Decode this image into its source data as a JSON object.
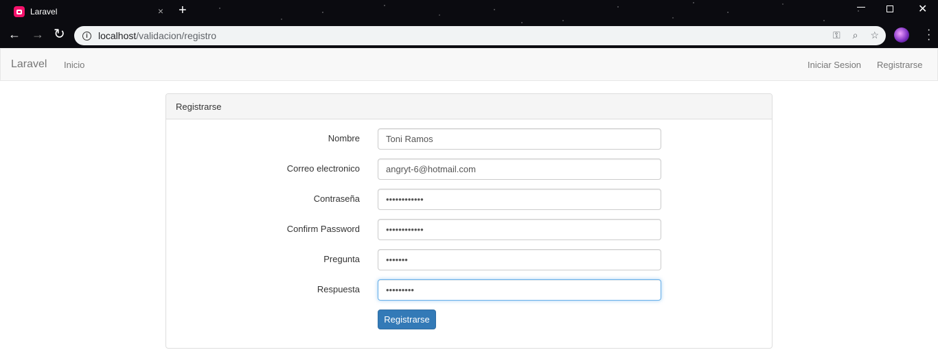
{
  "browser": {
    "tab_title": "Laravel",
    "tab_close": "×",
    "new_tab": "+",
    "url_host": "localhost",
    "url_path": "/validacion/registro",
    "icons": [
      "back-icon",
      "forward-icon",
      "reload-icon",
      "info-icon",
      "key-icon",
      "zoom-icon",
      "star-icon",
      "profile-avatar",
      "menu-icon"
    ],
    "window_controls": [
      "minimize-icon",
      "restore-icon",
      "close-icon"
    ]
  },
  "navbar": {
    "brand": "Laravel",
    "left_links": [
      "Inicio"
    ],
    "right_links": [
      "Iniciar Sesion",
      "Registrarse"
    ]
  },
  "panel": {
    "heading": "Registrarse",
    "fields": [
      {
        "label": "Nombre",
        "value": "Toni Ramos",
        "type": "text"
      },
      {
        "label": "Correo electronico",
        "value": "angryt-6@hotmail.com",
        "type": "email"
      },
      {
        "label": "Contraseña",
        "value": "••••••••••••",
        "type": "password"
      },
      {
        "label": "Confirm Password",
        "value": "••••••••••••",
        "type": "password"
      },
      {
        "label": "Pregunta",
        "value": "•••••••",
        "type": "password"
      },
      {
        "label": "Respuesta",
        "value": "•••••••••",
        "type": "password",
        "focused": true
      }
    ],
    "submit_label": "Registrarse",
    "submit_color": "#337ab7"
  }
}
